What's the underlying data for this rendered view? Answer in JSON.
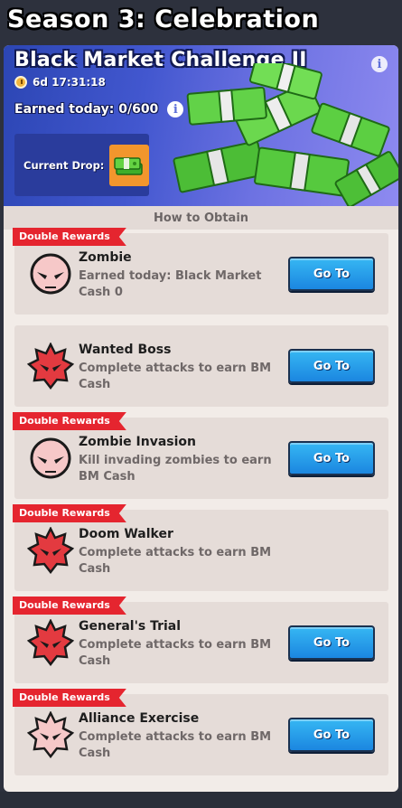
{
  "season_title": "Season 3: Celebration",
  "banner": {
    "title": "Black Market Challenge II",
    "timer": "6d 17:31:18",
    "earned_today": "Earned today: 0/600",
    "current_drop_label": "Current Drop:"
  },
  "how_to_obtain": "How to Obtain",
  "tasks": [
    {
      "badge": "Double Rewards",
      "title": "Zombie",
      "desc": "Earned today: Black Market Cash 0",
      "button": "Go To",
      "icon": "zombie-skull-icon"
    },
    {
      "badge": "",
      "title": "Wanted Boss",
      "desc": "Complete attacks to earn BM Cash",
      "button": "Go To",
      "icon": "spiked-skull-icon"
    },
    {
      "badge": "Double Rewards",
      "title": "Zombie Invasion",
      "desc": "Kill invading zombies to earn BM Cash",
      "button": "Go To",
      "icon": "zombie-skull-icon"
    },
    {
      "badge": "Double Rewards",
      "title": "Doom Walker",
      "desc": "Complete attacks to earn BM Cash",
      "button": "",
      "icon": "spiked-skull-icon"
    },
    {
      "badge": "Double Rewards",
      "title": "General's Trial",
      "desc": "Complete attacks to earn BM Cash",
      "button": "Go To",
      "icon": "spiked-skull-icon"
    },
    {
      "badge": "Double Rewards",
      "title": "Alliance Exercise",
      "desc": "Complete attacks to earn BM Cash",
      "button": "Go To",
      "icon": "spiked-skull-icon"
    }
  ],
  "colors": {
    "badge_red": "#e5252f",
    "button_blue": "#1b86e0",
    "banner_blue": "#3a50c6",
    "skull_red": "#e33a40",
    "skull_pink": "#f6c8c8"
  }
}
